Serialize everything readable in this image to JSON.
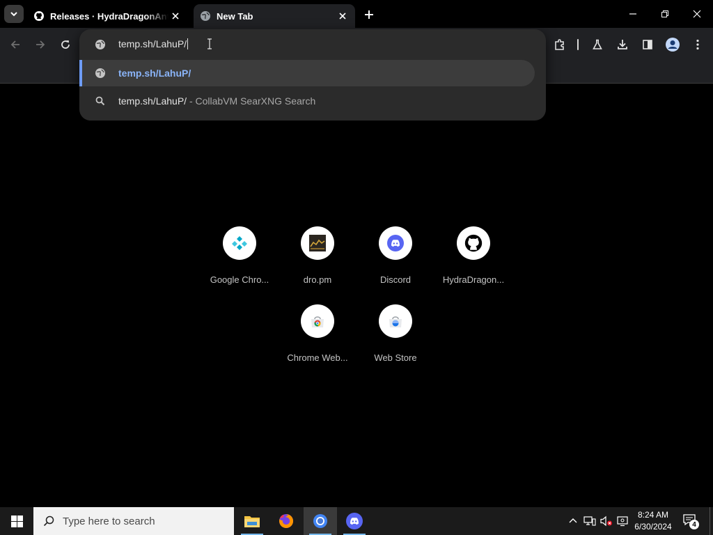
{
  "browser": {
    "tabs": [
      {
        "title": "Releases · HydraDragonAntivirus",
        "icon": "github-icon",
        "active": false
      },
      {
        "title": "New Tab",
        "icon": "globe-icon",
        "active": true
      }
    ]
  },
  "omnibox": {
    "input_value": "temp.sh/LahuP/",
    "suggestions": [
      {
        "text": "temp.sh/LahuP/",
        "suffix": "",
        "icon": "globe-icon",
        "selected": true
      },
      {
        "text": "temp.sh/LahuP/",
        "suffix": "- CollabVM SearXNG Search",
        "icon": "search-icon",
        "selected": false
      }
    ]
  },
  "shortcuts": [
    {
      "label": "Google Chro...",
      "icon": "chrome-remote-icon"
    },
    {
      "label": "dro.pm",
      "icon": "dropm-icon"
    },
    {
      "label": "Discord",
      "icon": "discord-icon"
    },
    {
      "label": "HydraDragon...",
      "icon": "github-icon"
    },
    {
      "label": "Chrome Web...",
      "icon": "chrome-web-store-icon"
    },
    {
      "label": "Web Store",
      "icon": "web-store-icon"
    }
  ],
  "taskbar": {
    "search_placeholder": "Type here to search",
    "apps": [
      "file-explorer-icon",
      "firefox-icon",
      "chrome-icon",
      "discord-icon"
    ],
    "clock": {
      "time": "8:24 AM",
      "date": "6/30/2024"
    },
    "notification_count": "4"
  },
  "colors": {
    "accent": "#8ab4f8",
    "selection_bar": "#6e9cf7",
    "toolbar_bg": "#202124",
    "dropdown_bg": "#2b2b2b"
  }
}
